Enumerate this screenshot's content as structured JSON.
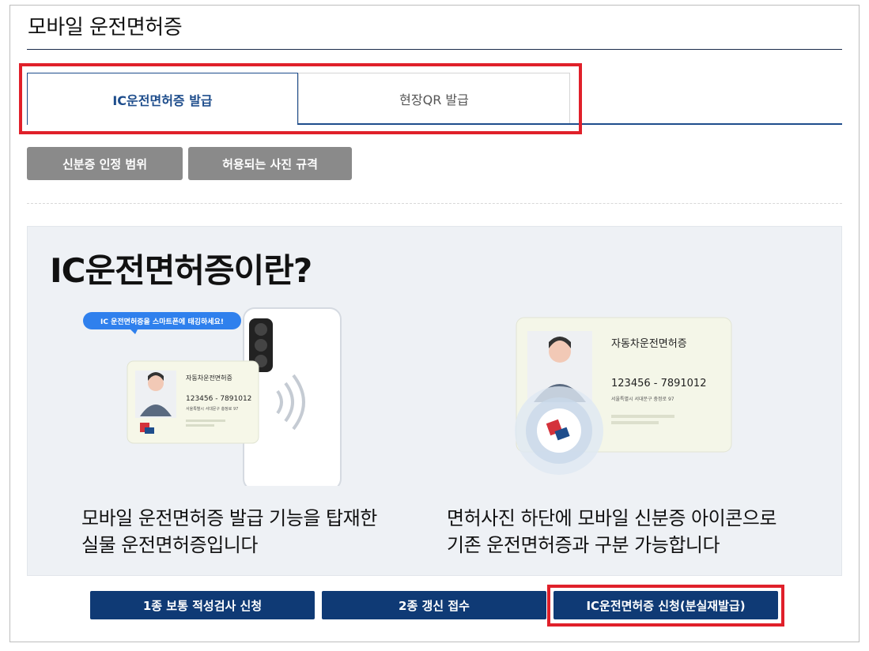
{
  "page": {
    "title": "모바일 운전면허증"
  },
  "tabs": [
    {
      "label": "IC운전면허증 발급",
      "active": true
    },
    {
      "label": "현장QR 발급",
      "active": false
    }
  ],
  "sub_buttons": [
    {
      "label": "신분증 인정 범위"
    },
    {
      "label": "허용되는 사진 규격"
    }
  ],
  "info": {
    "heading": "IC운전면허증이란?",
    "left_card": {
      "bubble": "IC 운전면허증을 스마트폰에 태깅하세요!",
      "card_title": "자동차운전면허증",
      "card_number": "123456 - 7891012",
      "card_address": "서울특별시 서대문구 충정로 97",
      "desc_line1": "모바일 운전면허증 발급 기능을 탑재한",
      "desc_line2": "실물 운전면허증입니다"
    },
    "right_card": {
      "card_title": "자동차운전면허증",
      "card_number": "123456 - 7891012",
      "card_address": "서울특별시 서대문구 충정로 97",
      "desc_line1": "면허사진 하단에 모바일 신분증 아이콘으로",
      "desc_line2": "기존 운전면허증과 구분 가능합니다"
    }
  },
  "action_buttons": [
    {
      "label": "1종 보통 적성검사 신청"
    },
    {
      "label": "2종 갱신 접수"
    },
    {
      "label": "IC운전면허증 신청(분실재발급)"
    }
  ],
  "colors": {
    "navy": "#0f3a75",
    "tab_blue": "#1e4d8c",
    "highlight_red": "#e0202a",
    "panel_bg": "#eef1f5",
    "gray_button": "#8a8a8a"
  }
}
